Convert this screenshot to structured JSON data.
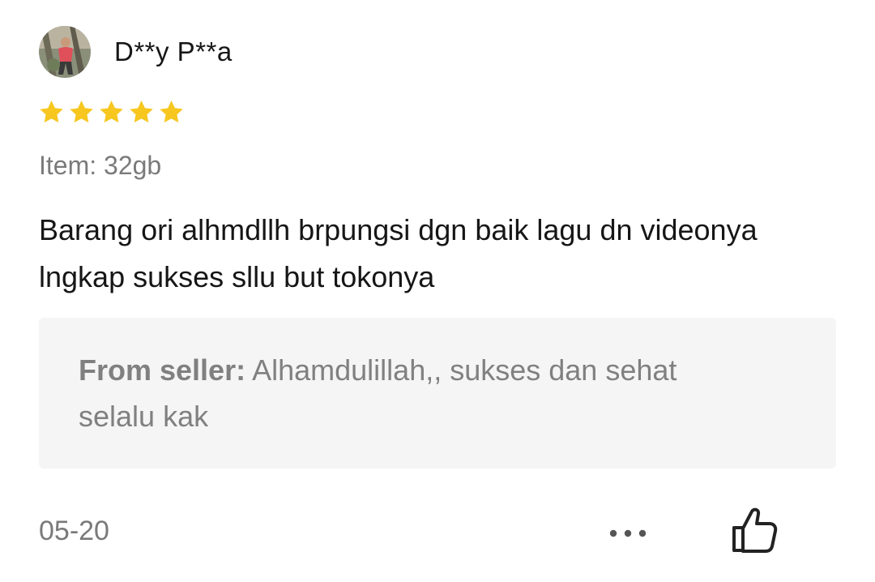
{
  "review": {
    "username": "D**y P**a",
    "rating": 5,
    "rating_max": 5,
    "item_label": "Item: 32gb",
    "text": "Barang ori alhmdllh brpungsi dgn baik lagu dn videonya lngkap sukses sllu but tokonya",
    "seller_reply": {
      "prefix": "From seller:",
      "text": "Alhamdulillah,, sukses dan sehat selalu kak"
    },
    "date": "05-20"
  },
  "icons": {
    "star": "star-icon",
    "more": "more-dots-icon",
    "like": "thumbs-up-icon"
  },
  "colors": {
    "star": "#f7c720",
    "secondary_text": "#7a7a7a",
    "seller_box_bg": "#f5f5f5"
  }
}
